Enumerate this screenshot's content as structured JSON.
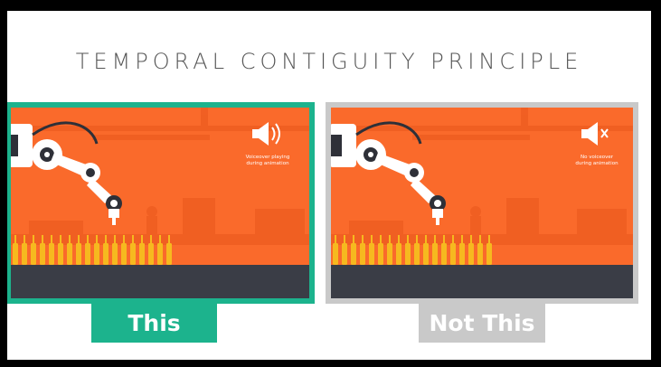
{
  "title": "TEMPORAL CONTIGUITY PRINCIPLE",
  "panels": {
    "left": {
      "label": "This",
      "caption_line1": "Voiceover playing",
      "caption_line2": "during animation",
      "icon": "speaker-on-icon",
      "border_color": "#1cb38d"
    },
    "right": {
      "label": "Not This",
      "caption_line1": "No voiceover",
      "caption_line2": "during animation",
      "icon": "speaker-muted-icon",
      "border_color": "#c9c9c9"
    }
  },
  "colors": {
    "scene_orange": "#fa6a2b",
    "conveyor": "#3a3d46",
    "bottles": "#f6b91f"
  }
}
